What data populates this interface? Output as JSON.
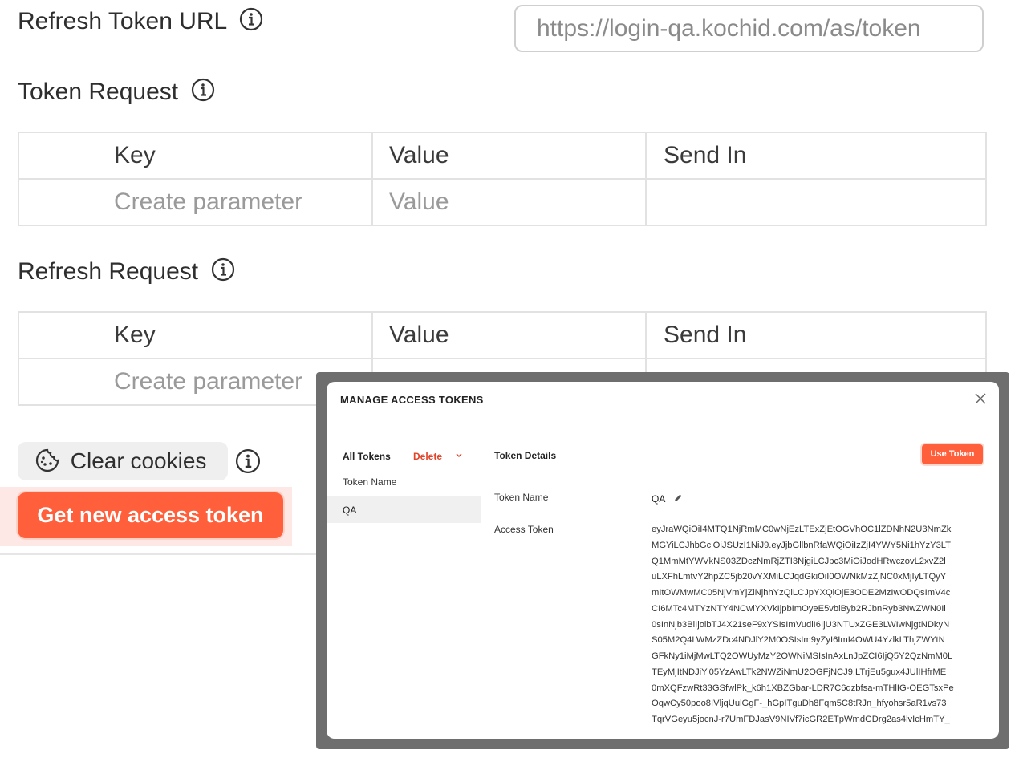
{
  "refresh_token_url": {
    "label": "Refresh Token URL",
    "value": "https://login-qa.kochid.com/as/token"
  },
  "token_request": {
    "title": "Token Request",
    "headers": [
      "Key",
      "Value",
      "Send In"
    ],
    "row": {
      "key_placeholder": "Create parameter",
      "value_placeholder": "Value",
      "send_in": ""
    }
  },
  "refresh_request": {
    "title": "Refresh Request",
    "headers": [
      "Key",
      "Value",
      "Send In"
    ],
    "row": {
      "key_placeholder": "Create parameter"
    }
  },
  "actions": {
    "clear_cookies": "Clear cookies",
    "get_new_token": "Get new access token"
  },
  "colors": {
    "accent": "#ff5f3a",
    "delete": "#e0442a"
  },
  "icons": [
    "info-icon",
    "cookie-icon",
    "close-icon",
    "chevron-down-icon",
    "pencil-icon"
  ],
  "modal": {
    "title": "MANAGE ACCESS TOKENS",
    "all_tokens": "All Tokens",
    "delete": "Delete",
    "token_name_header": "Token Name",
    "tokens": [
      "QA"
    ],
    "details_title": "Token Details",
    "use_token": "Use Token",
    "token_name_label": "Token Name",
    "token_name_value": "QA",
    "access_token_label": "Access Token",
    "access_token_lines": [
      "eyJraWQiOiI4MTQ1NjRmMC0wNjEzLTExZjEtOGVhOC1lZDNhN2U3NmZk",
      "MGYiLCJhbGciOiJSUzI1NiJ9.eyJjbGllbnRfaWQiOiIzZjI4YWY5Ni1hYzY3LT",
      "Q1MmMtYWVkNS03ZDczNmRjZTI3NjgiLCJpc3MiOiJodHRwczovL2xvZ2l",
      "uLXFhLmtvY2hpZC5jb20vYXMiLCJqdGkiOiI0OWNkMzZjNC0xMjIyLTQyY",
      "mItOWMwMC05NjVmYjZlNjhhYzQiLCJpYXQiOjE3ODE2MzIwODQsImV4c",
      "CI6MTc4MTYzNTY4NCwiYXVkIjpbImOyeE5vblByb2RJbnRyb3NwZWN0Il",
      "0sInNjb3BlIjoibTJ4X21seF9xYSIsImVudiI6IjU3NTUxZGE3LWIwNjgtNDkyN",
      "S05M2Q4LWMzZDc4NDJlY2M0OSIsIm9yZyI6ImI4OWU4YzlkLThjZWYtN",
      "GFkNy1iMjMwLTQ2OWUyMzY2OWNiMSIsInAxLnJpZCI6IjQ5Y2QzNmM0L",
      "TEyMjItNDJiYi05YzAwLTk2NWZiNmU2OGFjNCJ9.LTrjEu5gux4JUlIHfrME",
      "0mXQFzwRt33GSfwlPk_k6h1XBZGbar-LDR7C6qzbfsa-mTHlIG-OEGTsxPe",
      "OqwCy50poo8IVljqUulGgF-_hGpITguDh8Fqm5C8tRJn_hfyohsr5aR1vs73",
      "TqrVGeyu5jocnJ-r7UmFDJasV9NIVf7icGR2ETpWmdGDrg2as4lvIcHmTY_"
    ]
  }
}
